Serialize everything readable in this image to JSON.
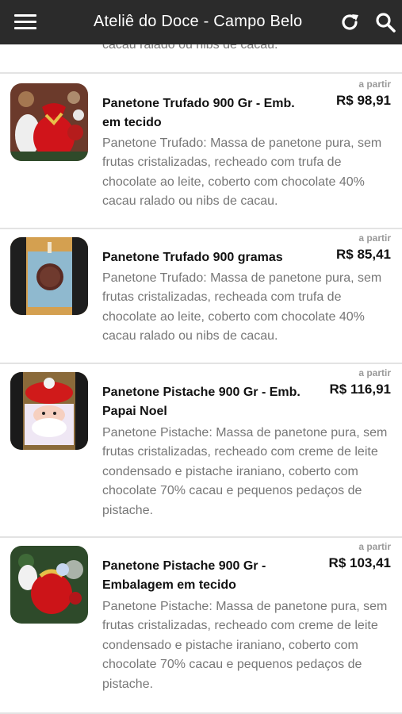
{
  "header": {
    "title": "Ateliê do Doce - Campo Belo",
    "menu_icon": "hamburger-menu-icon",
    "refresh_icon": "refresh-icon",
    "search_icon": "search-icon"
  },
  "top_fragment": "cacau ralado ou nibs de cacau.",
  "products": [
    {
      "from_label": "a partir",
      "price": "R$ 98,91",
      "name": "Panetone Trufado 900 Gr - Emb. em tecido",
      "description": "Panetone Trufado: Massa de panetone pura, sem frutas cristalizadas, recheado com trufa de chocolate ao leite, coberto com chocolate 40% cacau ralado ou nibs de cacau."
    },
    {
      "from_label": "a partir",
      "price": "R$ 85,41",
      "name": "Panetone Trufado 900 gramas",
      "description": "Panetone Trufado: Massa de panetone pura, sem frutas cristalizadas, recheada com trufa de chocolate ao leite, coberto com chocolate 40% cacau ralado ou nibs de cacau."
    },
    {
      "from_label": "a partir",
      "price": "R$ 116,91",
      "name": "Panetone Pistache 900 Gr - Emb. Papai Noel",
      "description": "Panetone Pistache: Massa de panetone pura, sem frutas cristalizadas, recheado com creme de leite condensado e pistache iraniano, coberto com chocolate 70% cacau e pequenos pedaços de pistache."
    },
    {
      "from_label": "a partir",
      "price": "R$ 103,41",
      "name": "Panetone Pistache 900 Gr - Embalagem em tecido",
      "description": "Panetone Pistache: Massa de panetone pura, sem frutas cristalizadas, recheado com creme de leite condensado e pistache iraniano, coberto com chocolate 70% cacau e pequenos pedaços de pistache."
    }
  ]
}
